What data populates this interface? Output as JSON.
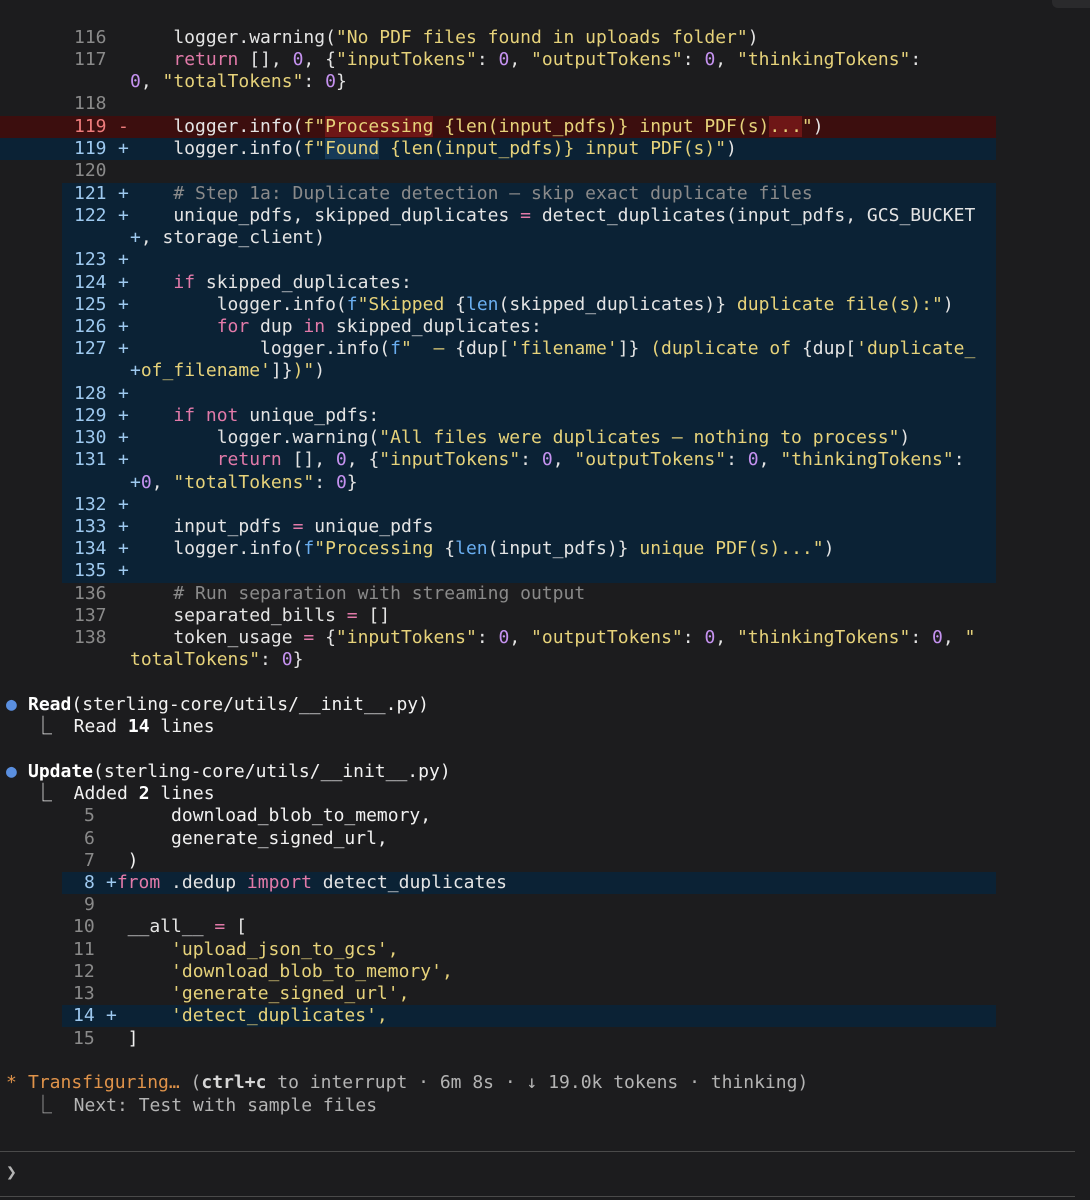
{
  "diff1": {
    "l116": {
      "num": "116",
      "code": "        logger.warning(\"No PDF files found in uploads folder\")"
    },
    "l117": {
      "num": "117",
      "a": "        ",
      "kw": "return",
      "b": " [], ",
      "n1": "0",
      ",": ", ",
      "s1": "{\"inputTokens\": ",
      "n2": "0",
      "s2": ", \"outputTokens\": ",
      "n3": "0",
      "s3": ", \"thinkingTokens\":"
    },
    "l117w": {
      "pre": "0",
      ", ": ", ",
      "s": "\"totalTokens\"",
      "c": ": ",
      "n": "0",
      "e": "}"
    },
    "l118": {
      "num": "118"
    },
    "l119d": {
      "num": "119",
      "mark": "-",
      "pre": "    logger.info(f\"",
      "hl": "Processing",
      "mid": " {len(input_pdfs)} input PDF(s)",
      "hl2": "...",
      "end": "\")"
    },
    "l119a": {
      "num": "119",
      "mark": "+",
      "pre": "    logger.info(f\"",
      "hl": "Found",
      "mid": " {len(input_pdfs)} input PDF(s)\")"
    },
    "l120": {
      "num": "120"
    },
    "l121": {
      "num": "121",
      "mark": "+",
      "code": "    # Step 1a: Duplicate detection – skip exact duplicate files"
    },
    "l122": {
      "num": "122",
      "mark": "+",
      "code": "    unique_pdfs, skipped_duplicates = detect_duplicates(input_pdfs, GCS_BUCKET"
    },
    "l122w": {
      "code": "+, storage_client)"
    },
    "l123": {
      "num": "123",
      "mark": "+"
    },
    "l124": {
      "num": "124",
      "mark": "+",
      "code": "    if skipped_duplicates:"
    },
    "l125": {
      "num": "125",
      "mark": "+",
      "code": "        logger.info(f\"Skipped {len(skipped_duplicates)} duplicate file(s):\")"
    },
    "l126": {
      "num": "126",
      "mark": "+",
      "code": "        for dup in skipped_duplicates:"
    },
    "l127": {
      "num": "127",
      "mark": "+",
      "code": "            logger.info(f\"  – {dup['filename']} (duplicate of {dup['duplicate_"
    },
    "l127w": {
      "code": "+of_filename']})\")"
    },
    "l128": {
      "num": "128",
      "mark": "+"
    },
    "l129": {
      "num": "129",
      "mark": "+",
      "code": "    if not unique_pdfs:"
    },
    "l130": {
      "num": "130",
      "mark": "+",
      "code": "        logger.warning(\"All files were duplicates – nothing to process\")"
    },
    "l131": {
      "num": "131",
      "mark": "+",
      "code": "        return [], 0, {\"inputTokens\": 0, \"outputTokens\": 0, \"thinkingTokens\":"
    },
    "l131w": {
      "code": "+0, \"totalTokens\": 0}"
    },
    "l132": {
      "num": "132",
      "mark": "+"
    },
    "l133": {
      "num": "133",
      "mark": "+",
      "code": "    input_pdfs = unique_pdfs"
    },
    "l134": {
      "num": "134",
      "mark": "+",
      "code": "    logger.info(f\"Processing {len(input_pdfs)} unique PDF(s)...\")"
    },
    "l135": {
      "num": "135",
      "mark": "+"
    },
    "l136": {
      "num": "136",
      "code": "    # Run separation with streaming output"
    },
    "l137": {
      "num": "137",
      "code": "    separated_bills = []"
    },
    "l138": {
      "num": "138",
      "code": "    token_usage = {\"inputTokens\": 0, \"outputTokens\": 0, \"thinkingTokens\": 0, \""
    },
    "l138w": {
      "code": "totalTokens\": 0}"
    }
  },
  "read_step": {
    "bullet": "●",
    "tool": "Read",
    "arg": "(sterling-core/utils/__init__.py)",
    "result_prefix": "⎿  Read ",
    "count": "14",
    "result_suffix": " lines"
  },
  "update_step": {
    "bullet": "●",
    "tool": "Update",
    "arg": "(sterling-core/utils/__init__.py)",
    "result_prefix": "⎿  Added ",
    "count": "2",
    "result_suffix": " lines"
  },
  "diff2": {
    "l5": {
      "num": "5",
      "code": "      download_blob_to_memory,"
    },
    "l6": {
      "num": "6",
      "code": "      generate_signed_url,"
    },
    "l7": {
      "num": "7",
      "code": "  )"
    },
    "l8": {
      "num": "8",
      "mark": "+",
      "code": "from .dedup import detect_duplicates"
    },
    "l9": {
      "num": "9"
    },
    "l10": {
      "num": "10",
      "code": "  __all__ = ["
    },
    "l11": {
      "num": "11",
      "code": "      'upload_json_to_gcs',"
    },
    "l12": {
      "num": "12",
      "code": "      'download_blob_to_memory',"
    },
    "l13": {
      "num": "13",
      "code": "      'generate_signed_url',"
    },
    "l14": {
      "num": "14",
      "mark": "+",
      "code": "      'detect_duplicates',"
    },
    "l15": {
      "num": "15",
      "code": "  ]"
    }
  },
  "status": {
    "spinner": "*",
    "label": "Transfiguring…",
    "paren_open": " (",
    "key": "ctrl+c",
    "interrupt": " to interrupt · 6m 8s · ↓ 19.0k tokens · thinking)",
    "next": "⎿  Next: Test with sample files"
  },
  "prompt": {
    "symbol": "❯"
  }
}
